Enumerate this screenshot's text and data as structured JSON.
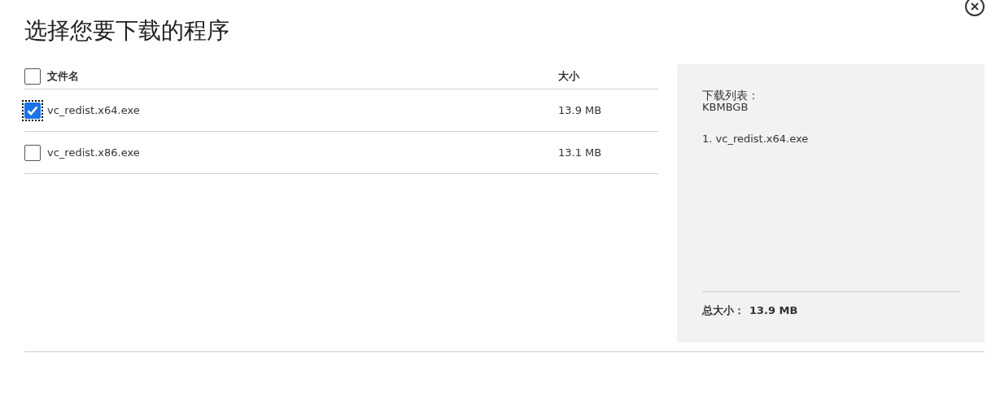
{
  "dialog": {
    "title": "选择您要下载的程序"
  },
  "table": {
    "header": {
      "checked": false,
      "columns": [
        "文件名",
        "大小"
      ]
    },
    "rows": [
      {
        "name": "vc_redist.x64.exe",
        "size": "13.9 MB",
        "checked": true,
        "focused": true
      },
      {
        "name": "vc_redist.x86.exe",
        "size": "13.1 MB",
        "checked": false,
        "focused": false
      }
    ]
  },
  "summary": {
    "heading": "下载列表：",
    "code": "KBMBGB",
    "items": [
      "1. vc_redist.x64.exe"
    ],
    "total_label": "总大小：",
    "total_value": "13.9 MB"
  }
}
